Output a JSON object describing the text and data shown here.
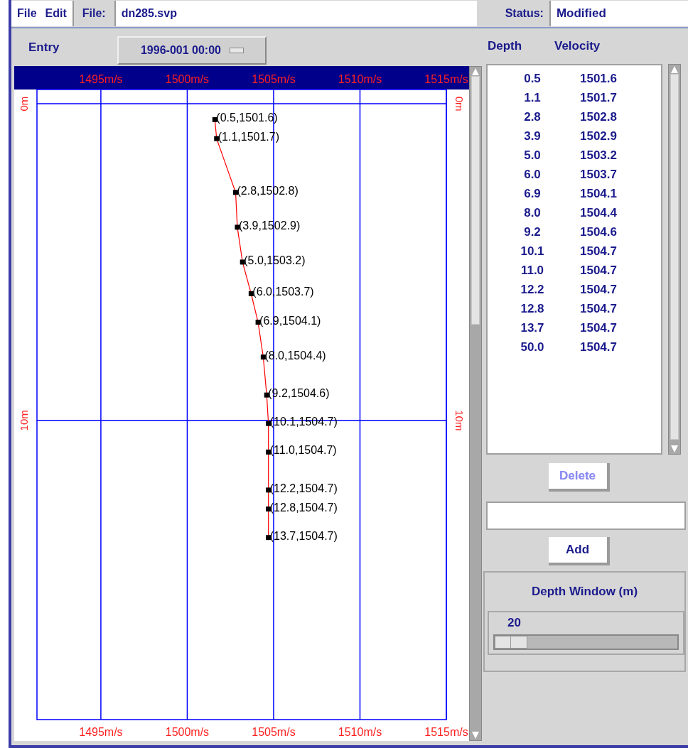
{
  "menu": [
    "File",
    "Edit"
  ],
  "file": {
    "label": "File:",
    "value": "dn285.svp"
  },
  "status": {
    "label": "Status:",
    "value": "Modified"
  },
  "entry": {
    "label": "Entry",
    "value": "1996-001 00:00"
  },
  "chart": {
    "chart_data": {
      "type": "line",
      "grid": true,
      "xlim": [
        1491.3,
        1515
      ],
      "ylim": [
        19.45,
        -0.45
      ],
      "xticks": [
        {
          "value": 1495,
          "label": "1495m/s"
        },
        {
          "value": 1500,
          "label": "1500m/s"
        },
        {
          "value": 1505,
          "label": "1505m/s"
        },
        {
          "value": 1510,
          "label": "1510m/s"
        },
        {
          "value": 1515,
          "label": "1515m/s"
        }
      ],
      "yticks": [
        {
          "value": 0,
          "label": "0m"
        },
        {
          "value": 10,
          "label": "10m"
        }
      ],
      "x": [
        1501.6,
        1501.7,
        1502.8,
        1502.9,
        1503.2,
        1503.7,
        1504.1,
        1504.4,
        1504.6,
        1504.7,
        1504.7,
        1504.7,
        1504.7,
        1504.7
      ],
      "series": [
        {
          "color": "#ff0000",
          "marker": "square",
          "values": [
            0.5,
            1.1,
            2.8,
            3.9,
            5.0,
            6.0,
            6.9,
            8.0,
            9.2,
            10.1,
            11.0,
            12.2,
            12.8,
            13.7
          ]
        }
      ],
      "value_labels": [
        "(0.5,1501.6)",
        "(1.1,1501.7)",
        "(2.8,1502.8)",
        "(3.9,1502.9)",
        "(5.0,1503.2)",
        "(6.0,1503.7)",
        "(6.9,1504.1)",
        "(8.0,1504.4)",
        "(9.2,1504.6)",
        "(10.1,1504.7)",
        "(11.0,1504.7)",
        "(12.2,1504.7)",
        "(12.8,1504.7)",
        "(13.7,1504.7)"
      ]
    }
  },
  "table": {
    "columns": [
      "Depth",
      "Velocity"
    ],
    "rows": [
      [
        "0.5",
        "1501.6"
      ],
      [
        "1.1",
        "1501.7"
      ],
      [
        "2.8",
        "1502.8"
      ],
      [
        "3.9",
        "1502.9"
      ],
      [
        "5.0",
        "1503.2"
      ],
      [
        "6.0",
        "1503.7"
      ],
      [
        "6.9",
        "1504.1"
      ],
      [
        "8.0",
        "1504.4"
      ],
      [
        "9.2",
        "1504.6"
      ],
      [
        "10.1",
        "1504.7"
      ],
      [
        "11.0",
        "1504.7"
      ],
      [
        "12.2",
        "1504.7"
      ],
      [
        "12.8",
        "1504.7"
      ],
      [
        "13.7",
        "1504.7"
      ],
      [
        "50.0",
        "1504.7"
      ]
    ]
  },
  "delete_button": {
    "label": "Delete",
    "disabled": true
  },
  "add_button": {
    "label": "Add"
  },
  "depth_window": {
    "title": "Depth Window (m)",
    "reading": "20",
    "level": 0
  }
}
